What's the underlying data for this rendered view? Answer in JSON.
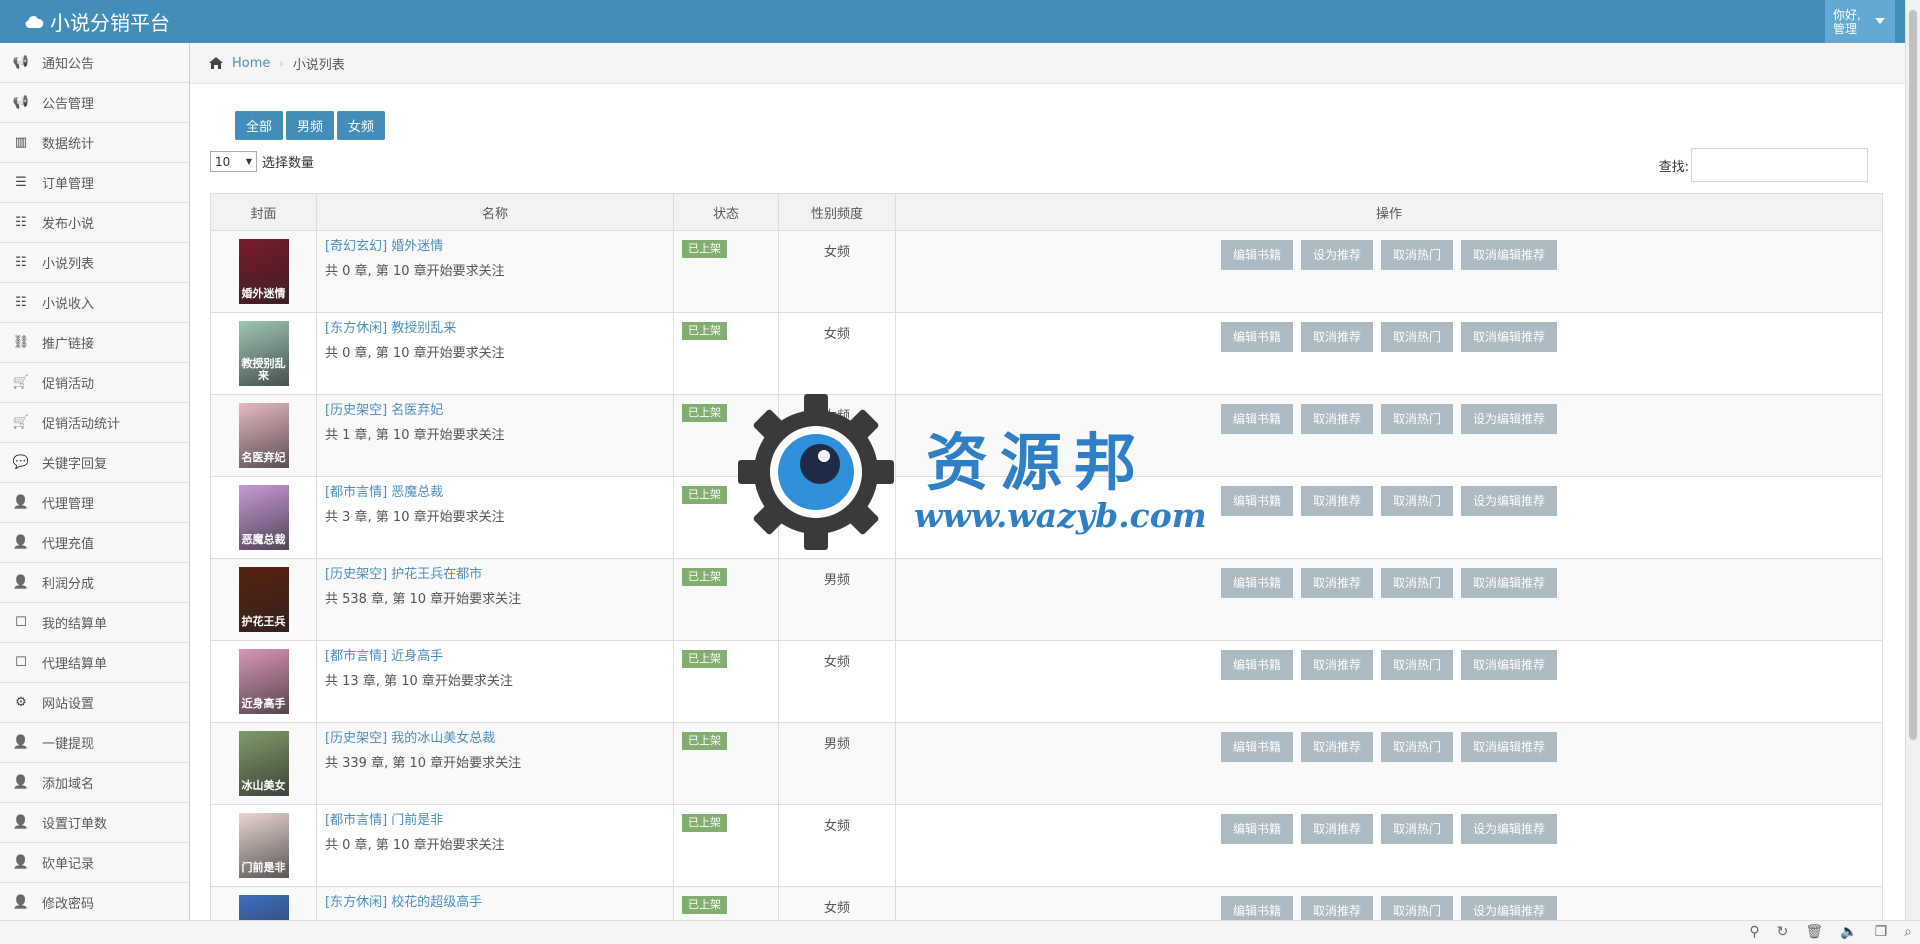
{
  "header": {
    "brand": "小说分销平台",
    "user_greeting": "你好,",
    "user_name": "管理"
  },
  "sidebar": {
    "items": [
      {
        "label": "通知公告",
        "icon": "bullhorn-icon"
      },
      {
        "label": "公告管理",
        "icon": "bullhorn-icon"
      },
      {
        "label": "数据统计",
        "icon": "bar-chart-icon"
      },
      {
        "label": "订单管理",
        "icon": "list-icon"
      },
      {
        "label": "发布小说",
        "icon": "tasks-icon"
      },
      {
        "label": "小说列表",
        "icon": "tasks-icon"
      },
      {
        "label": "小说收入",
        "icon": "tasks-icon"
      },
      {
        "label": "推广链接",
        "icon": "link-icon"
      },
      {
        "label": "促销活动",
        "icon": "cart-icon"
      },
      {
        "label": "促销活动统计",
        "icon": "cart-icon"
      },
      {
        "label": "关键字回复",
        "icon": "comment-icon"
      },
      {
        "label": "代理管理",
        "icon": "user-plus-icon"
      },
      {
        "label": "代理充值",
        "icon": "user-plus-icon"
      },
      {
        "label": "利润分成",
        "icon": "user-plus-icon"
      },
      {
        "label": "我的结算单",
        "icon": "edit-icon"
      },
      {
        "label": "代理结算单",
        "icon": "edit-icon"
      },
      {
        "label": "网站设置",
        "icon": "cogs-icon"
      },
      {
        "label": "一键提现",
        "icon": "user-plus-icon"
      },
      {
        "label": "添加域名",
        "icon": "user-plus-icon"
      },
      {
        "label": "设置订单数",
        "icon": "user-plus-icon"
      },
      {
        "label": "砍单记录",
        "icon": "user-plus-icon"
      },
      {
        "label": "修改密码",
        "icon": "user-plus-icon"
      }
    ]
  },
  "breadcrumb": {
    "home": "Home",
    "current": "小说列表"
  },
  "filters": {
    "all": "全部",
    "male": "男频",
    "female": "女频"
  },
  "page_length": {
    "value": "10",
    "label": "选择数量"
  },
  "search": {
    "label": "查找:",
    "value": ""
  },
  "table": {
    "headers": [
      "封面",
      "名称",
      "状态",
      "性别频度",
      "操作"
    ],
    "rows": [
      {
        "title": "[奇幻玄幻] 婚外迷情",
        "sub": "共 0 章, 第 10 章开始要求关注",
        "status": "已上架",
        "gender": "女频",
        "ops": [
          "编辑书籍",
          "设为推荐",
          "取消热门",
          "取消编辑推荐"
        ],
        "cover_text": "婚外迷情",
        "cover_color": "#7a1b2a"
      },
      {
        "title": "[东方休闲] 教授别乱来",
        "sub": "共 0 章, 第 10 章开始要求关注",
        "status": "已上架",
        "gender": "女频",
        "ops": [
          "编辑书籍",
          "取消推荐",
          "取消热门",
          "取消编辑推荐"
        ],
        "cover_text": "教授别乱来",
        "cover_color": "#9fc6b5"
      },
      {
        "title": "[历史架空] 名医弃妃",
        "sub": "共 1 章, 第 10 章开始要求关注",
        "status": "已上架",
        "gender": "女频",
        "ops": [
          "编辑书籍",
          "取消推荐",
          "取消热门",
          "设为编辑推荐"
        ],
        "cover_text": "名医弃妃",
        "cover_color": "#e7b9c4"
      },
      {
        "title": "[都市言情] 恶魔总裁",
        "sub": "共 3 章, 第 10 章开始要求关注",
        "status": "已上架",
        "gender": "女频",
        "ops": [
          "编辑书籍",
          "取消推荐",
          "取消热门",
          "设为编辑推荐"
        ],
        "cover_text": "恶魔总裁",
        "cover_color": "#c79ad6"
      },
      {
        "title": "[历史架空] 护花王兵在都市",
        "sub": "共 538 章, 第 10 章开始要求关注",
        "status": "已上架",
        "gender": "男频",
        "ops": [
          "编辑书籍",
          "取消推荐",
          "取消热门",
          "取消编辑推荐"
        ],
        "cover_text": "护花王兵",
        "cover_color": "#5a2310"
      },
      {
        "title": "[都市言情] 近身高手",
        "sub": "共 13 章, 第 10 章开始要求关注",
        "status": "已上架",
        "gender": "女频",
        "ops": [
          "编辑书籍",
          "取消推荐",
          "取消热门",
          "取消编辑推荐"
        ],
        "cover_text": "近身高手",
        "cover_color": "#d996b8"
      },
      {
        "title": "[历史架空] 我的冰山美女总裁",
        "sub": "共 339 章, 第 10 章开始要求关注",
        "status": "已上架",
        "gender": "男频",
        "ops": [
          "编辑书籍",
          "取消推荐",
          "取消热门",
          "取消编辑推荐"
        ],
        "cover_text": "冰山美女",
        "cover_color": "#7f9b6a"
      },
      {
        "title": "[都市言情] 门前是非",
        "sub": "共 0 章, 第 10 章开始要求关注",
        "status": "已上架",
        "gender": "女频",
        "ops": [
          "编辑书籍",
          "取消推荐",
          "取消热门",
          "设为编辑推荐"
        ],
        "cover_text": "门前是非",
        "cover_color": "#e9d6d2"
      },
      {
        "title": "[东方休闲] 校花的超级高手",
        "sub": "",
        "status": "已上架",
        "gender": "女频",
        "ops": [
          "编辑书籍",
          "取消推荐",
          "取消热门",
          "设为编辑推荐"
        ],
        "cover_text": "",
        "cover_color": "#3e6fc1"
      }
    ]
  },
  "watermark": {
    "text": "资源邦",
    "url": "www.wazyb.com"
  }
}
